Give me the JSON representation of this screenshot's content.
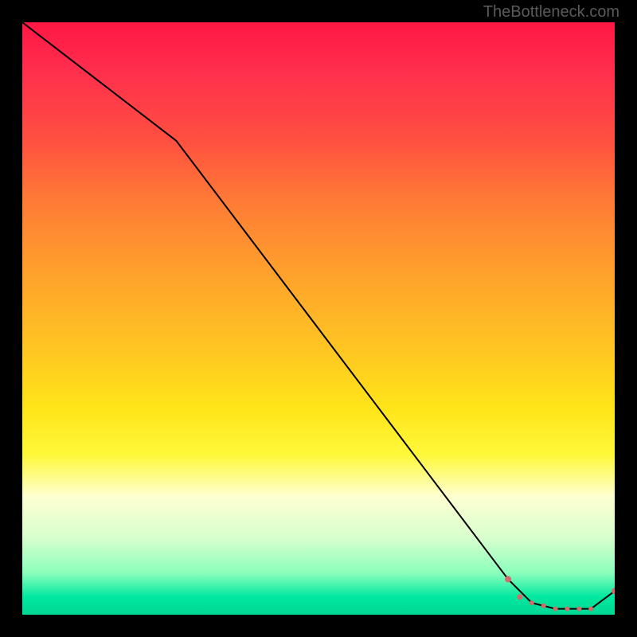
{
  "watermark": "TheBottleneck.com",
  "chart_data": {
    "type": "line",
    "title": "",
    "xlabel": "",
    "ylabel": "",
    "xlim": [
      0,
      100
    ],
    "ylim": [
      0,
      100
    ],
    "line": {
      "x": [
        0,
        26,
        82,
        86,
        90,
        93,
        96,
        100
      ],
      "values": [
        100,
        80,
        6,
        2,
        1,
        1,
        1,
        4
      ]
    },
    "markers": {
      "x": [
        82,
        84,
        86,
        88,
        90,
        92,
        94,
        96,
        100
      ],
      "values": [
        6,
        3,
        2,
        1.5,
        1,
        1,
        1,
        1,
        4
      ],
      "sizes": [
        4,
        3.5,
        3,
        3,
        3,
        3,
        3,
        3,
        4
      ]
    },
    "background_gradient": {
      "top": "#ff1744",
      "mid": "#ffe419",
      "bottom": "#00d894"
    },
    "grid": false,
    "legend": false
  }
}
